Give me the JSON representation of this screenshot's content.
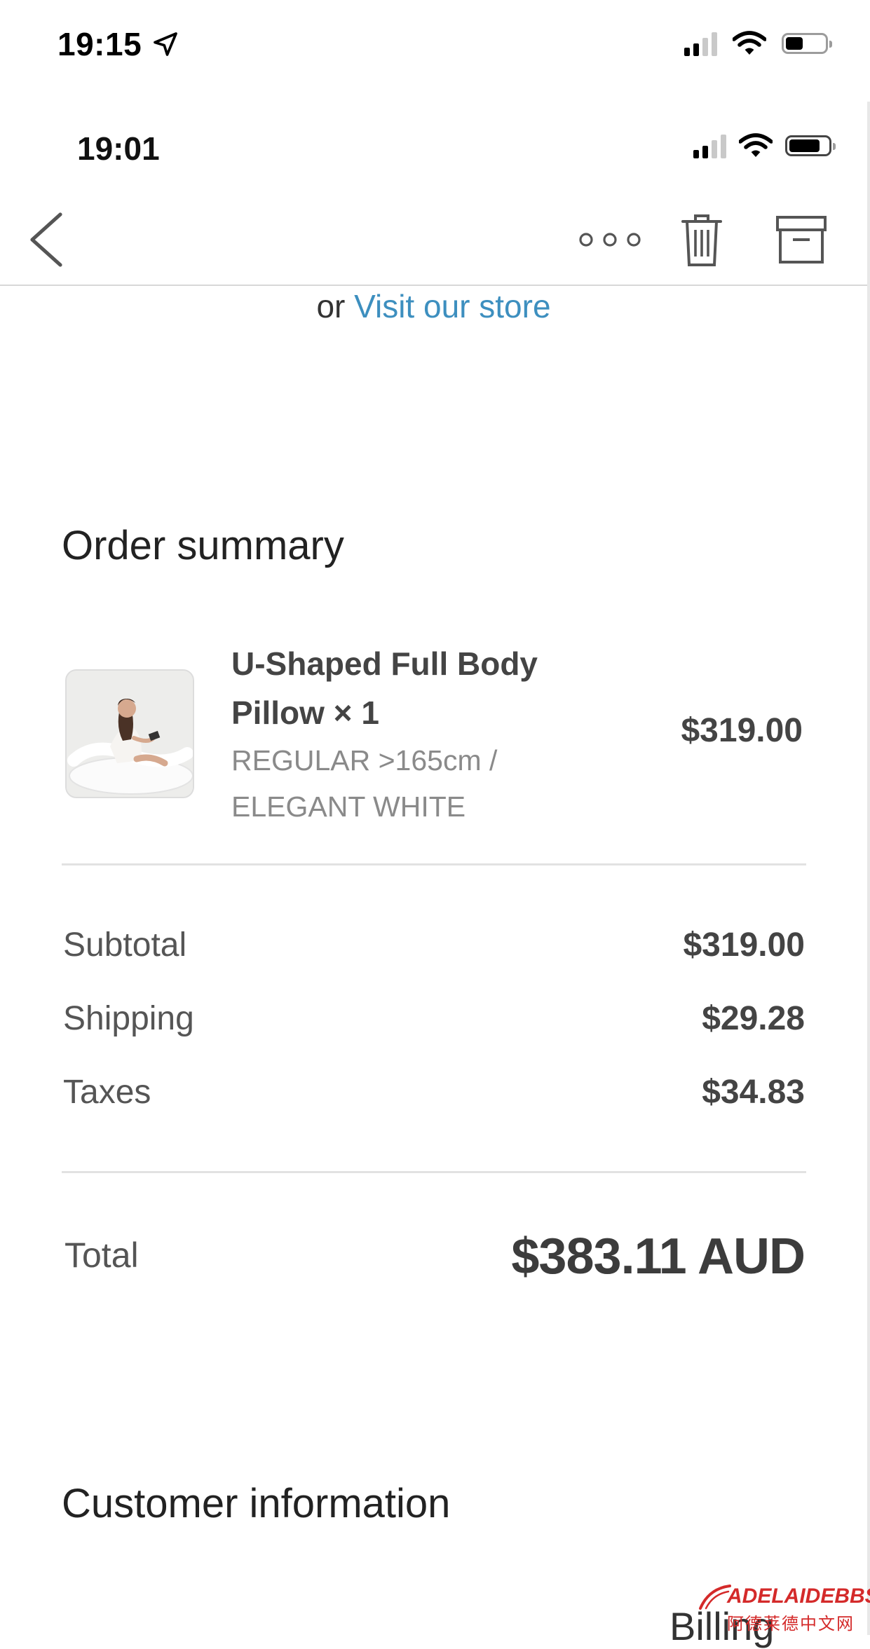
{
  "status_bar": {
    "time": "19:15"
  },
  "inner_status_bar": {
    "time": "19:01"
  },
  "store_link": {
    "prefix": "or",
    "link_text": "Visit our store"
  },
  "order_summary": {
    "heading": "Order summary",
    "item": {
      "title_line1": "U-Shaped Full Body",
      "title_line2": "Pillow × 1",
      "variant_line1": "REGULAR >165cm /",
      "variant_line2": "ELEGANT WHITE",
      "price": "$319.00"
    },
    "rows": [
      {
        "label": "Subtotal",
        "value": "$319.00"
      },
      {
        "label": "Shipping",
        "value": "$29.28"
      },
      {
        "label": "Taxes",
        "value": "$34.83"
      }
    ],
    "total": {
      "label": "Total",
      "value": "$383.11 AUD"
    }
  },
  "customer_information": {
    "heading": "Customer information"
  },
  "billing": {
    "partial_text": "Billing"
  },
  "watermark": {
    "top": "ADELAIDEBBS",
    "bottom": "阿德莱德中文网"
  },
  "icons": {
    "location": "location-arrow-icon",
    "back": "chevron-left-icon",
    "more": "more-icon",
    "trash": "trash-icon",
    "archive": "archive-icon"
  },
  "colors": {
    "link": "#3d8fbf",
    "text_dark": "#444444",
    "text_muted": "#8a8a8a"
  }
}
